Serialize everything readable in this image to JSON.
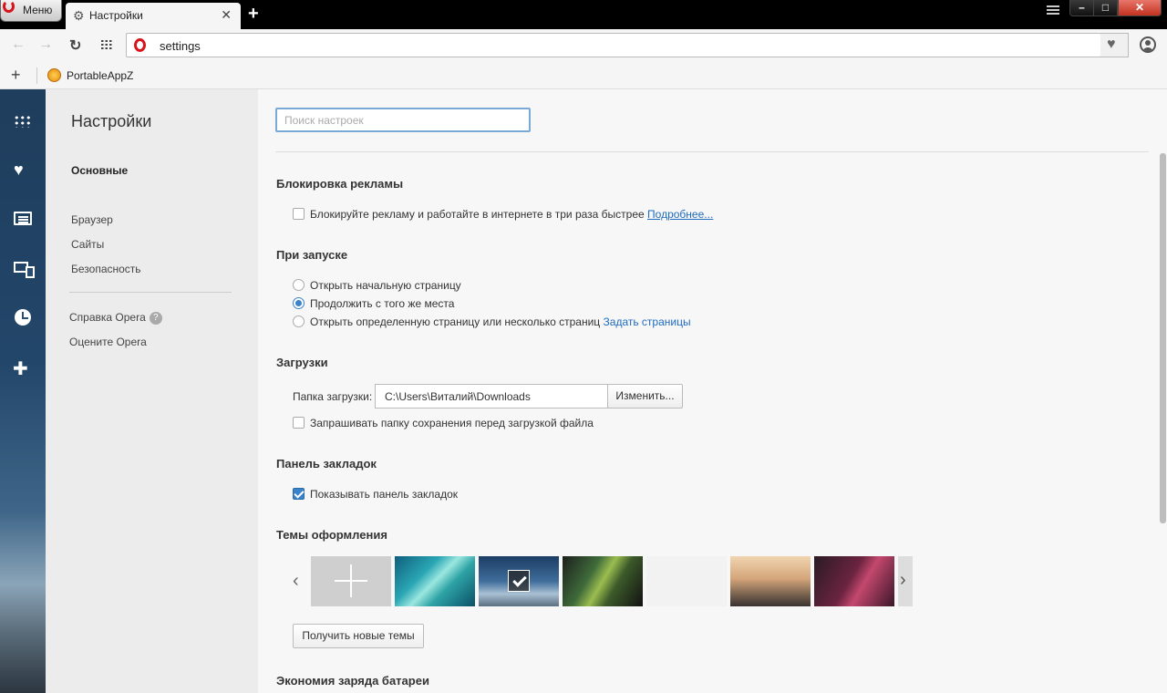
{
  "titlebar": {
    "menu_label": "Меню",
    "tab_title": "Настройки",
    "tab_close": "✕",
    "new_tab": "+",
    "window_controls": {
      "minimize": "–",
      "maximize": "□",
      "close": "✕"
    }
  },
  "addressbar": {
    "back": "←",
    "forward": "→",
    "reload": "↻",
    "url": "settings",
    "heart": "♥"
  },
  "bookmarks_bar": {
    "add": "+",
    "items": [
      {
        "label": "PortableAppZ"
      }
    ]
  },
  "sidepanel": {
    "heart": "♥",
    "extensions": "✚"
  },
  "settings_nav": {
    "title": "Настройки",
    "basic": "Основные",
    "sections": [
      "Браузер",
      "Сайты",
      "Безопасность"
    ],
    "help": "Справка Opera",
    "help_icon": "?",
    "rate": "Оцените Opera"
  },
  "main": {
    "search_placeholder": "Поиск настроек",
    "adblock": {
      "title": "Блокировка рекламы",
      "checkbox_label": "Блокируйте рекламу и работайте в интернете в три раза быстрее",
      "more_link": "Подробнее...",
      "checked": false
    },
    "startup": {
      "title": "При запуске",
      "options": [
        {
          "label": "Открыть начальную страницу",
          "selected": false
        },
        {
          "label": "Продолжить с того же места",
          "selected": true
        },
        {
          "label": "Открыть определенную страницу или несколько страниц",
          "selected": false
        }
      ],
      "set_pages_link": "Задать страницы"
    },
    "downloads": {
      "title": "Загрузки",
      "folder_label": "Папка загрузки:",
      "folder_path": "C:\\Users\\Виталий\\Downloads",
      "change_button": "Изменить...",
      "ask_label": "Запрашивать папку сохранения перед загрузкой файла",
      "ask_checked": false
    },
    "bookmarks": {
      "title": "Панель закладок",
      "show_label": "Показывать панель закладок",
      "show_checked": true
    },
    "themes": {
      "title": "Темы оформления",
      "prev": "‹",
      "next": "›",
      "selected_index": 2,
      "get_more_button": "Получить новые темы"
    },
    "battery": {
      "title": "Экономия заряда батареи"
    }
  }
}
